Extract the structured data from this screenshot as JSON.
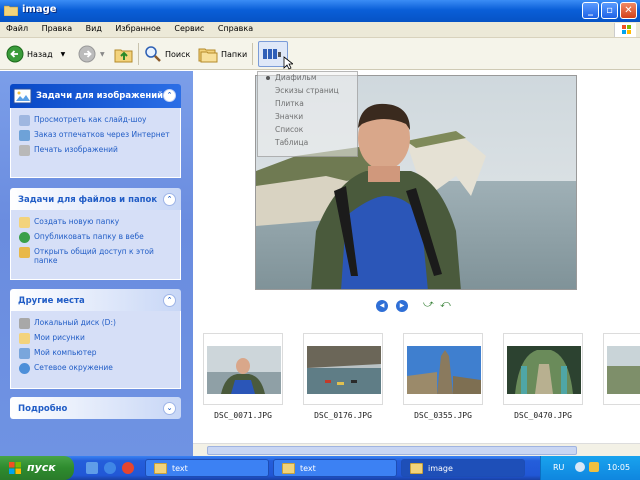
{
  "window": {
    "title": "image"
  },
  "menu": [
    "Файл",
    "Правка",
    "Вид",
    "Избранное",
    "Сервис",
    "Справка"
  ],
  "toolbar": {
    "back_label": "Назад",
    "search_label": "Поиск",
    "folders_label": "Папки"
  },
  "views_menu": [
    "Диафильм",
    "Эскизы страниц",
    "Плитка",
    "Значки",
    "Список",
    "Таблица"
  ],
  "views_menu_selected": "Диафильм",
  "taskpane": {
    "image_tasks": {
      "title": "Задачи для изображений",
      "items": [
        "Просмотреть как слайд-шоу",
        "Заказ отпечатков через Интернет",
        "Печать изображений"
      ]
    },
    "file_tasks": {
      "title": "Задачи для файлов и папок",
      "items": [
        "Создать новую папку",
        "Опубликовать папку в вебе",
        "Открыть общий доступ к этой папке"
      ]
    },
    "other_places": {
      "title": "Другие места",
      "items": [
        "Локальный диск (D:)",
        "Мои рисунки",
        "Мой компьютер",
        "Сетевое окружение"
      ]
    },
    "details": {
      "title": "Подробно"
    }
  },
  "filmstrip": [
    "DSC_0071.JPG",
    "DSC_0176.JPG",
    "DSC_0355.JPG",
    "DSC_0470.JPG"
  ],
  "taskbar": {
    "start_label": "пуск",
    "tasks": [
      "text",
      "text",
      "image"
    ],
    "active_task": "image",
    "language": "RU",
    "clock": "10:05"
  },
  "colors": {
    "titlebar": "#0a5fd8",
    "taskpane": "#6f93e3",
    "start": "#2e8b2e",
    "link": "#215dc6"
  }
}
